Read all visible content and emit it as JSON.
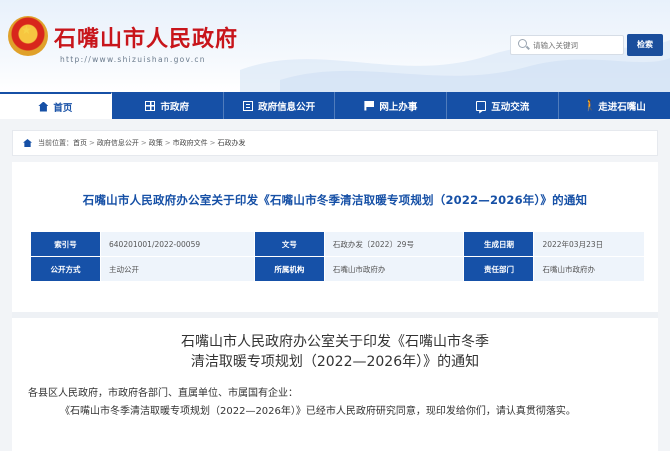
{
  "header": {
    "site_title": "石嘴山市人民政府",
    "site_url": "http://www.shizuishan.gov.cn",
    "search_placeholder": "请输入关键词",
    "search_button": "检索"
  },
  "nav": {
    "items": [
      {
        "label": "首页",
        "icon": "home-icon"
      },
      {
        "label": "市政府",
        "icon": "grid-icon"
      },
      {
        "label": "政府信息公开",
        "icon": "document-icon"
      },
      {
        "label": "网上办事",
        "icon": "flag-icon"
      },
      {
        "label": "互动交流",
        "icon": "chat-icon"
      },
      {
        "label": "走进石嘴山",
        "icon": "walk-icon"
      }
    ]
  },
  "breadcrumb": {
    "prefix": "当前位置：",
    "items": [
      "首页",
      "政府信息公开",
      "政策",
      "市政府文件",
      "石政办发"
    ],
    "separator": ">"
  },
  "document": {
    "title": "石嘴山市人民政府办公室关于印发《石嘴山市冬季清洁取暖专项规划（2022—2026年）》的通知",
    "meta": {
      "index_label": "索引号",
      "index_value": "640201001/2022-00059",
      "docno_label": "文号",
      "docno_value": "石政办发〔2022〕29号",
      "date_label": "生成日期",
      "date_value": "2022年03月23日",
      "open_label": "公开方式",
      "open_value": "主动公开",
      "org_label": "所属机构",
      "org_value": "石嘴山市政府办",
      "dept_label": "责任部门",
      "dept_value": "石嘴山市政府办"
    }
  },
  "article": {
    "title_line1": "石嘴山市人民政府办公室关于印发《石嘴山市冬季",
    "title_line2": "清洁取暖专项规划（2022—2026年）》的通知",
    "para1": "各县区人民政府，市政府各部门、直属单位、市属国有企业：",
    "para2": "《石嘴山市冬季清洁取暖专项规划（2022—2026年）》已经市人民政府研究同意，现印发给你们，请认真贯彻落实。"
  },
  "colors": {
    "brand_red": "#c8151b",
    "nav_blue": "#1650a6",
    "meta_key_bg": "#1651a8",
    "meta_val_bg": "#eef4fb"
  }
}
